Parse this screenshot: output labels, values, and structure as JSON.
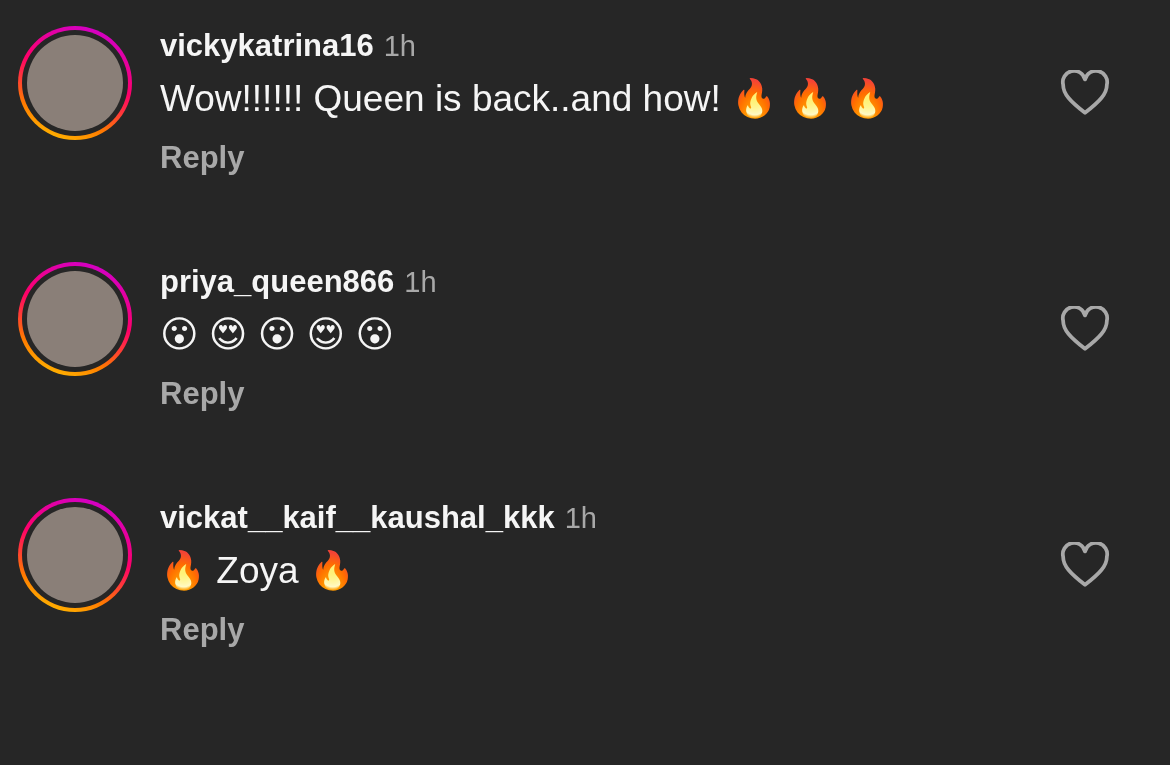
{
  "comments": [
    {
      "username": "vickykatrina16",
      "time": "1h",
      "text": "Wow!!!!!! Queen is back..and how! 🔥 🔥 🔥",
      "reply": "Reply",
      "liked": false
    },
    {
      "username": "priya_queen866",
      "time": "1h",
      "text": "😮 😍 😮 😍 😮",
      "reply": "Reply",
      "liked": false
    },
    {
      "username": "vickat__kaif__kaushal_kkk",
      "time": "1h",
      "text": "🔥  Zoya  🔥",
      "reply": "Reply",
      "liked": false
    }
  ]
}
